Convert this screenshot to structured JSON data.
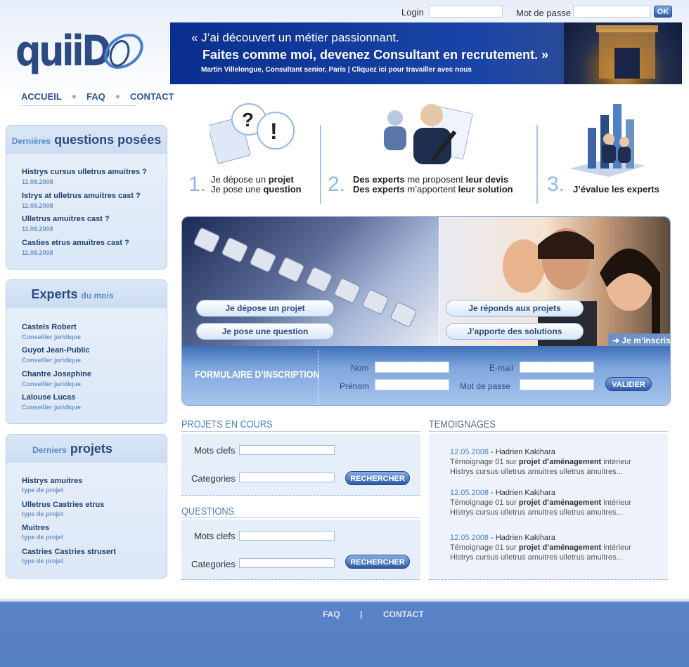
{
  "header": {
    "login_label": "Login",
    "password_label": "Mot de passe",
    "ok_label": "OK"
  },
  "logo": {
    "text": "quiiD"
  },
  "nav": {
    "items": [
      "ACCUEIL",
      "FAQ",
      "CONTACT"
    ]
  },
  "banner": {
    "line1": "« J’ai découvert un métier passionnant.",
    "line2": "Faites comme moi, devenez Consultant en recrutement. »",
    "line3": "Martin Villelongue, Consultant senior, Paris | Cliquez ici pour travailler avec nous"
  },
  "sidebar": {
    "questions": {
      "title_small": "Dernières",
      "title_big": "questions posées",
      "items": [
        {
          "label": "Histrys cursus ulletrus amuitres ?",
          "sub": "11.08.2008"
        },
        {
          "label": "Istrys at ulletrus amuitres cast ?",
          "sub": "11.08.2008"
        },
        {
          "label": "Ulletrus amuitres cast ?",
          "sub": "11.08.2008"
        },
        {
          "label": "Casties etrus amuitres cast ?",
          "sub": "11.08.2008"
        }
      ]
    },
    "experts": {
      "title_big": "Experts",
      "title_small": "du mois",
      "items": [
        {
          "label": "Castels Robert",
          "sub": "Conseiller juridique"
        },
        {
          "label": "Guyot Jean-Public",
          "sub": "Conseiller juridique"
        },
        {
          "label": "Chantre Josephine",
          "sub": "Conseiller juridique"
        },
        {
          "label": "Lalouse Lucas",
          "sub": "Conseiller juridique"
        }
      ]
    },
    "projets": {
      "title_small": "Derniers",
      "title_big": "projets",
      "items": [
        {
          "label": "Histrys amuitres",
          "sub": "type de projet"
        },
        {
          "label": "Ulletrus Castries etrus",
          "sub": "type de projet"
        },
        {
          "label": "Muitres",
          "sub": "type de projet"
        },
        {
          "label": "Castries Castries strusert",
          "sub": "type de projet"
        }
      ]
    }
  },
  "steps": [
    {
      "num": "1.",
      "l1_a": "Je dépose un ",
      "l1_b": "projet",
      "l2_a": "Je pose une ",
      "l2_b": "question"
    },
    {
      "num": "2.",
      "l1_a": "Des experts",
      "l1_b": " me proposent ",
      "l1_c": "leur devis",
      "l2_a": "Des experts",
      "l2_b": " m’apportent ",
      "l2_c": "leur solution"
    },
    {
      "num": "3.",
      "l1_a": "J’évalue les experts"
    }
  ],
  "hero": {
    "btn1": "Je dépose un projet",
    "btn2": "Je pose une question",
    "btn3": "Je réponds aux projets",
    "btn4": "J’apporte des solutions",
    "inscris": "Je m’inscris"
  },
  "form": {
    "title": "FORMULAIRE D’INSCRIPTION",
    "nom": "Nom",
    "prenom": "Prénom",
    "email": "E-mail",
    "password": "Mot de passe",
    "submit": "VALIDER"
  },
  "projets_en_cours": {
    "title": "PROJETS EN COURS",
    "keywords_label": "Mots clefs",
    "categories_label": "Categories",
    "search": "RECHERCHER"
  },
  "questions": {
    "title": "QUESTIONS",
    "keywords_label": "Mots clefs",
    "categories_label": "Categories",
    "search": "RECHERCHER"
  },
  "temoignages": {
    "title": "TEMOIGNAGES",
    "items": [
      {
        "date": "12.05.2008",
        "author": " - Hadrien Kakihara",
        "pre": "Témoignage 01 sur ",
        "bold": "projet d’aménagement",
        "post": " intérieur",
        "line3": "Histrys cursus ulletrus amuitres ulletrus amuitres..."
      },
      {
        "date": "12.05.2008",
        "author": " - Hadrien Kakihara",
        "pre": "Témoignage 01 sur ",
        "bold": "projet d’aménagement",
        "post": " intérieur",
        "line3": "Histrys cursus ulletrus amuitres ulletrus amuitres..."
      },
      {
        "date": "12.05.2008",
        "author": " - Hadrien Kakihara",
        "pre": "Témoignage 01 sur ",
        "bold": "projet d’aménagement",
        "post": " intérieur",
        "line3": "Histrys cursus ulletrus amuitres ulletrus amuitres..."
      }
    ]
  },
  "footer": {
    "faq": "FAQ",
    "sep": "|",
    "contact": "CONTACT"
  }
}
